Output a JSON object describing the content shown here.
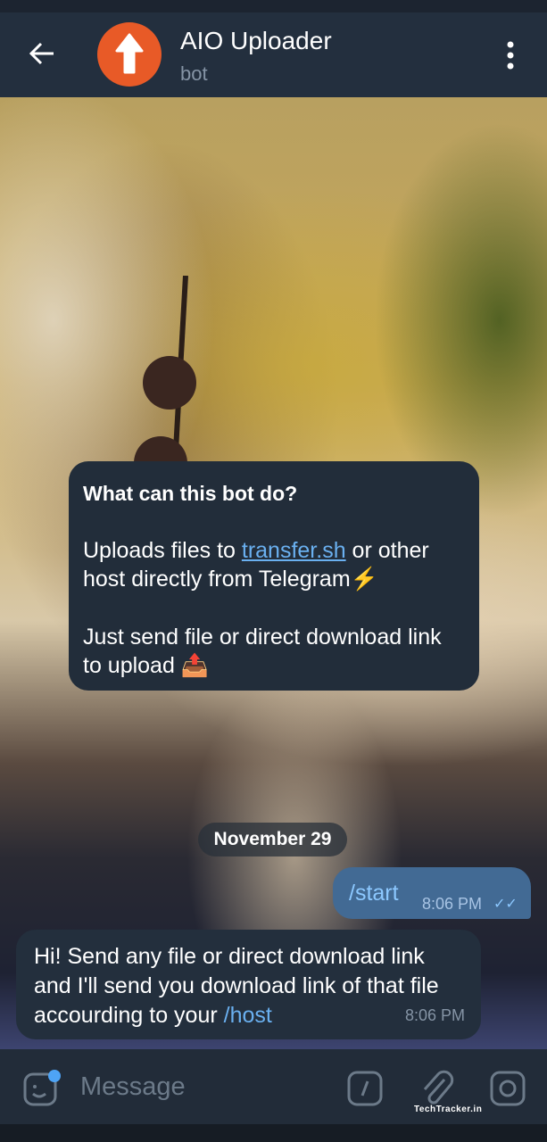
{
  "header": {
    "title": "AIO Uploader",
    "subtitle": "bot",
    "avatar_color": "#e85a27"
  },
  "intro": {
    "heading": "What can this bot do?",
    "p1_before": "Uploads files to ",
    "p1_link": "transfer.sh",
    "p1_after": " or other host directly from Telegram⚡",
    "p2": "Just send file or direct download link to upload 📤"
  },
  "date_label": "November 29",
  "messages": [
    {
      "direction": "outgoing",
      "text": "/start",
      "time": "8:06 PM",
      "status": "read"
    },
    {
      "direction": "incoming",
      "text": "Hi! Send any file or direct download link and I'll send you download link of that file accourding to your ",
      "command": "/host",
      "time": "8:06 PM"
    }
  ],
  "input": {
    "placeholder": "Message"
  },
  "watermark": "TechTracker.in"
}
